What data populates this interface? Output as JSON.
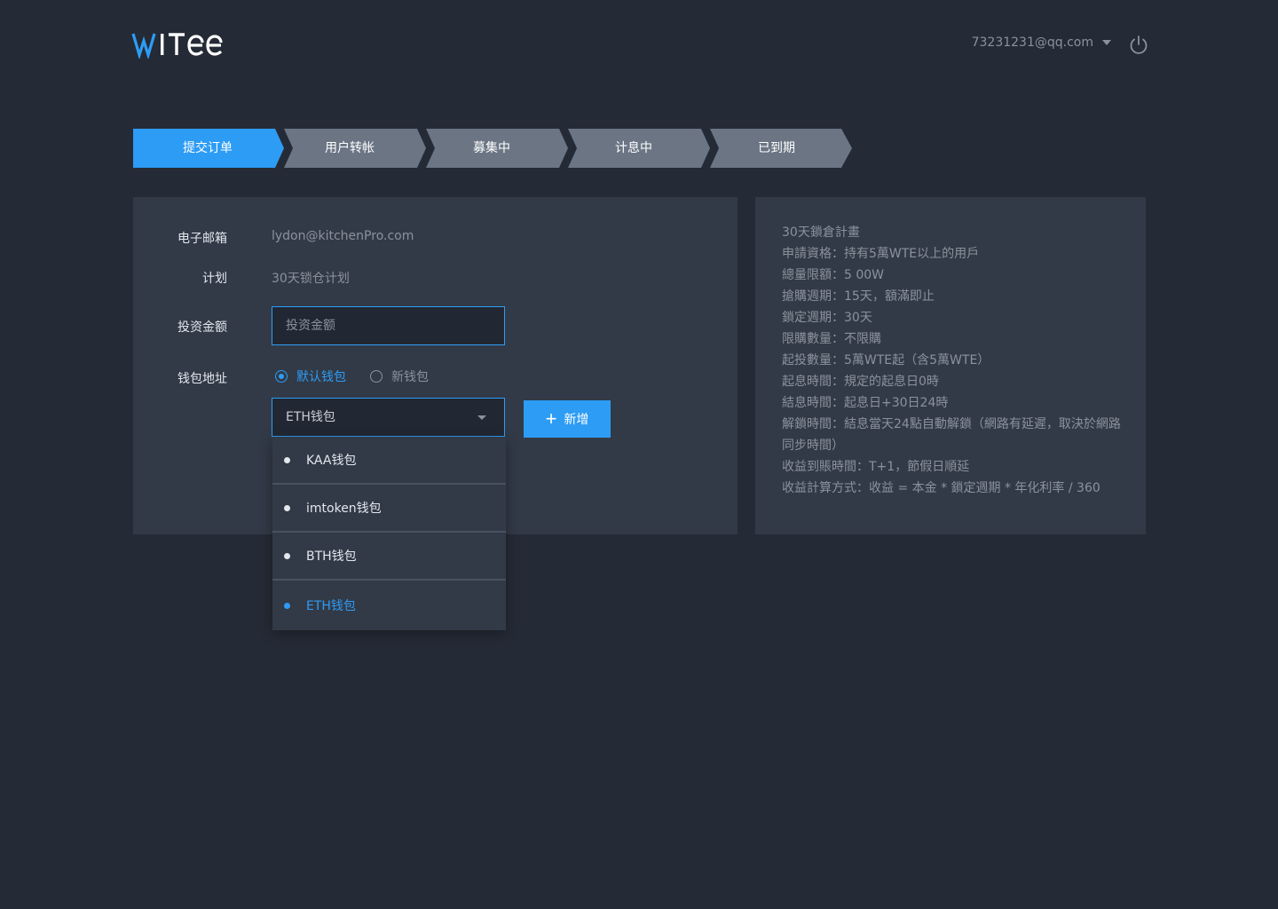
{
  "header": {
    "logo_text": "WITee",
    "user_email": "73231231@qq.com"
  },
  "steps": [
    {
      "label": "提交订单",
      "active": true
    },
    {
      "label": "用户转帐",
      "active": false
    },
    {
      "label": "募集中",
      "active": false
    },
    {
      "label": "计息中",
      "active": false
    },
    {
      "label": "已到期",
      "active": false
    }
  ],
  "form": {
    "email_label": "电子邮箱",
    "email_value": "lydon@kitchenPro.com",
    "plan_label": "计划",
    "plan_value": "30天锁仓计划",
    "amount_label": "投资金额",
    "amount_placeholder": "投资金额",
    "wallet_label": "钱包地址",
    "radio_default": "默认钱包",
    "radio_new": "新钱包",
    "selected_wallet": "ETH钱包",
    "add_button": "新增"
  },
  "dropdown": {
    "options": [
      {
        "label": "KAA钱包",
        "selected": false
      },
      {
        "label": "imtoken钱包",
        "selected": false
      },
      {
        "label": "BTH钱包",
        "selected": false
      },
      {
        "label": "ETH钱包",
        "selected": true
      }
    ]
  },
  "info": {
    "lines": [
      "30天鎖倉計畫",
      "申請資格：持有5萬WTE以上的用戶",
      "總量限額：5 00W",
      "搶購週期：15天，額滿即止",
      "鎖定週期：30天",
      "限購數量：不限購",
      "起投數量：5萬WTE起（含5萬WTE）",
      "起息時間：規定的起息日0時",
      "結息時間：起息日+30日24時",
      "解鎖時間：結息當天24點自動解鎖（網路有延遲，取決於網路同步時間）",
      "收益到賬時間：T+1，節假日順延",
      "收益計算方式：收益 = 本金 * 鎖定週期 * 年化利率 / 360"
    ]
  },
  "colors": {
    "background": "#252b36",
    "panel": "#323a47",
    "accent": "#2d9cf5",
    "step_inactive": "#6b7584"
  },
  "icons": [
    "logo",
    "caret-down-icon",
    "power-icon",
    "plus-icon",
    "chevron-down-icon"
  ]
}
